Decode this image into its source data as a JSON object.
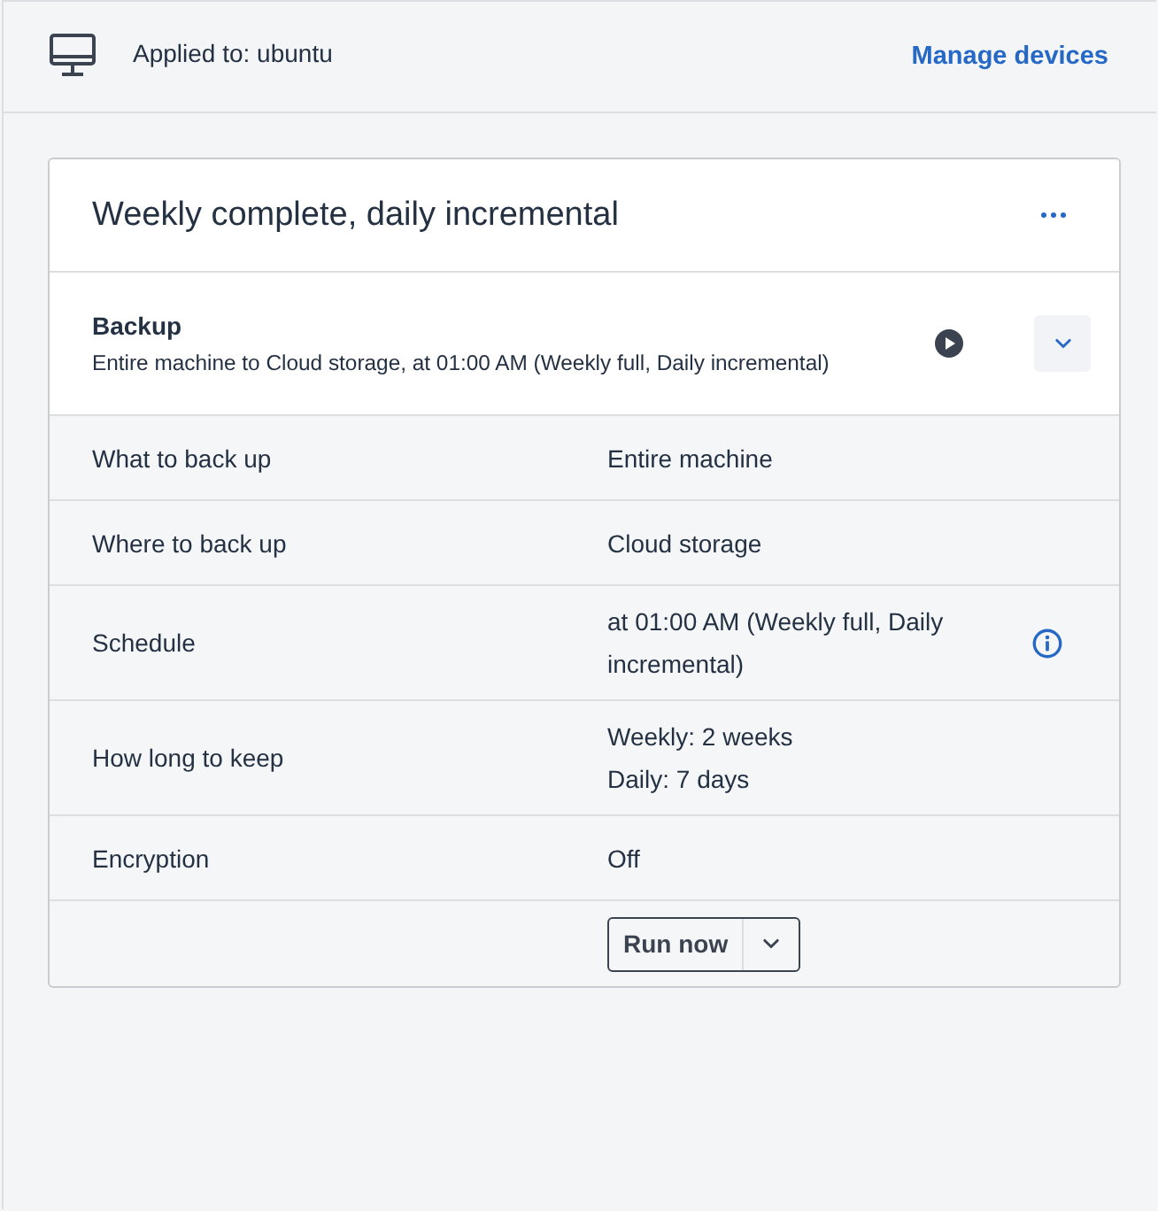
{
  "header": {
    "applied_to": "Applied to: ubuntu",
    "manage_link": "Manage devices"
  },
  "plan": {
    "title": "Weekly complete, daily incremental"
  },
  "backup": {
    "title": "Backup",
    "summary": "Entire machine to Cloud storage, at 01:00 AM (Weekly full, Daily incremental)"
  },
  "details": [
    {
      "label": "What to back up",
      "values": [
        "Entire machine"
      ],
      "info": false
    },
    {
      "label": "Where to back up",
      "values": [
        "Cloud storage"
      ],
      "info": false
    },
    {
      "label": "Schedule",
      "values": [
        "at 01:00 AM (Weekly full, Daily incremental)"
      ],
      "info": true
    },
    {
      "label": "How long to keep",
      "values": [
        "Weekly: 2 weeks",
        "Daily: 7 days"
      ],
      "info": false
    },
    {
      "label": "Encryption",
      "values": [
        "Off"
      ],
      "info": false
    }
  ],
  "run_button": {
    "label": "Run now"
  }
}
